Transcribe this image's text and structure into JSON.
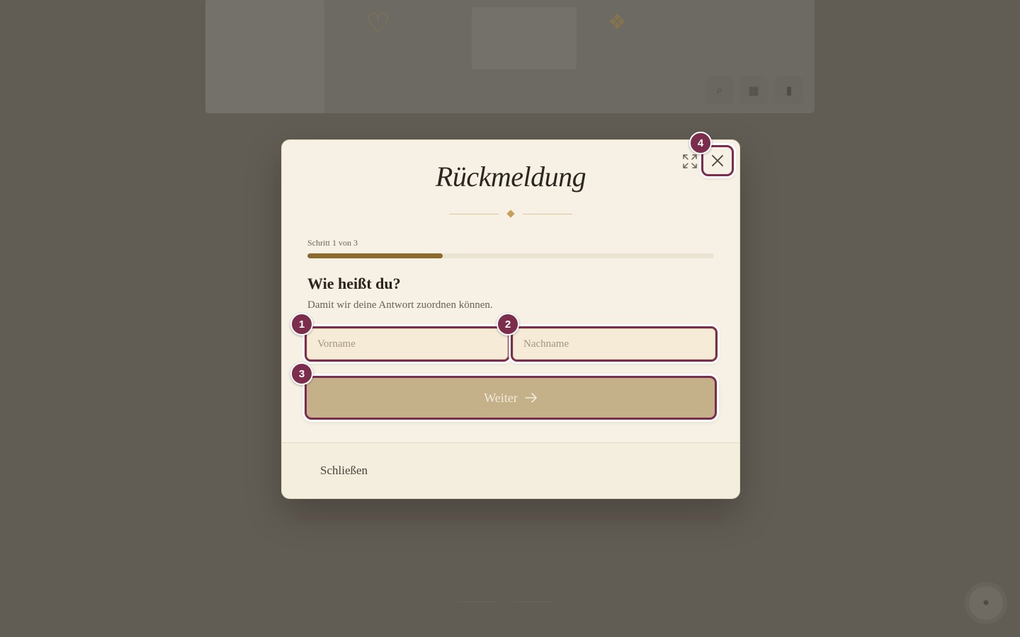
{
  "modal": {
    "title": "Rückmeldung",
    "step_label": "Schritt 1 von 3",
    "progress": 0.333,
    "question": "Wie heißt du?",
    "subtext": "Damit wir deine Antwort zuordnen können.",
    "first_name_placeholder": "Vorname",
    "last_name_placeholder": "Nachname",
    "next_label": "Weiter",
    "close_label": "Schließen",
    "expand_icon": "expand-icon",
    "close_icon": "close-icon"
  },
  "annotations": {
    "badge1": "1",
    "badge2": "2",
    "badge3": "3",
    "badge4": "4"
  },
  "colors": {
    "accent": "#7c2d4c",
    "progress": "#8b6a2e",
    "button": "#c4b089",
    "overlay": "#625d54",
    "modal_bg": "#f6f1e4"
  }
}
